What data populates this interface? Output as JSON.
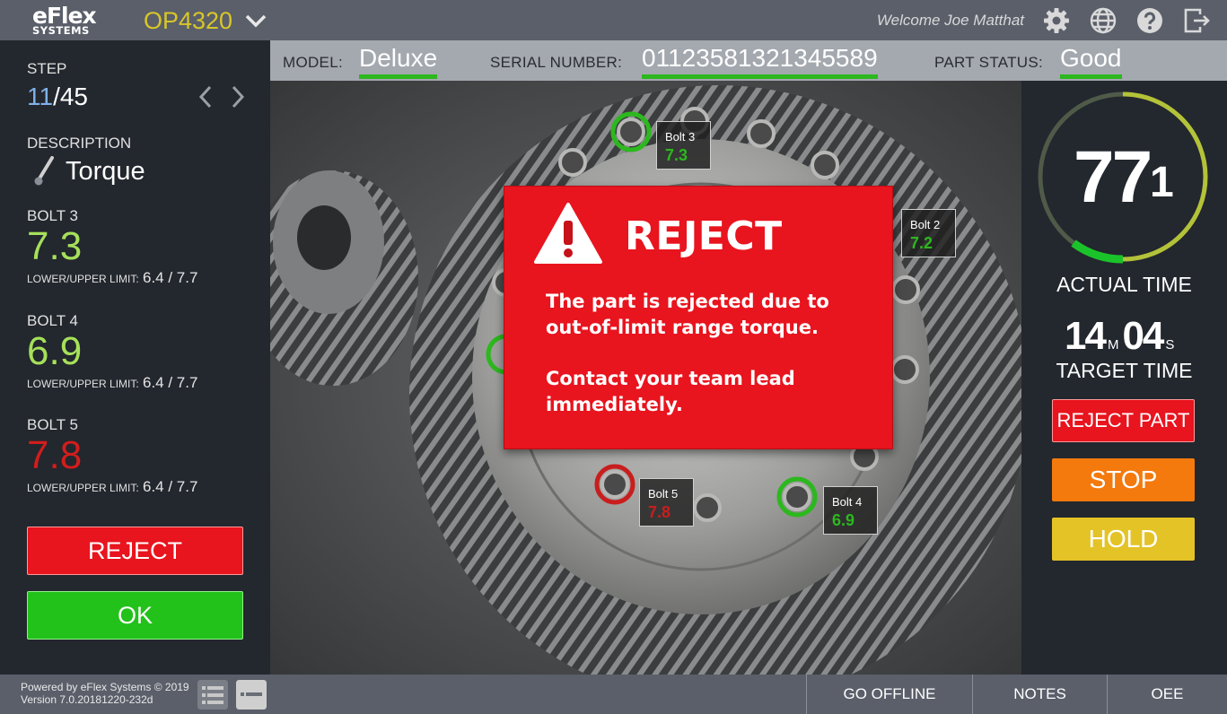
{
  "header": {
    "logo_line1": "eFlex",
    "logo_line2": "SYSTEMS",
    "operation": "OP4320",
    "welcome": "Welcome Joe Matthat",
    "icons": [
      "settings-gear-icon",
      "language-globe-icon",
      "help-icon",
      "logout-icon"
    ]
  },
  "infobar": {
    "model_label": "MODEL:",
    "model_value": "Deluxe",
    "serial_label": "SERIAL NUMBER:",
    "serial_value": "01123581321345589",
    "status_label": "PART STATUS:",
    "status_value": "Good"
  },
  "step": {
    "label": "STEP",
    "current": "11",
    "total": "/45"
  },
  "description": {
    "label": "DESCRIPTION",
    "value": "Torque"
  },
  "bolts": [
    {
      "label": "BOLT 3",
      "value": "7.3",
      "limit_label": "LOWER/UPPER LIMIT:",
      "limit": "6.4 / 7.7",
      "color": "#a6e05a"
    },
    {
      "label": "BOLT 4",
      "value": "6.9",
      "limit_label": "LOWER/UPPER LIMIT:",
      "limit": "6.4 / 7.7",
      "color": "#a6e05a"
    },
    {
      "label": "BOLT 5",
      "value": "7.8",
      "limit_label": "LOWER/UPPER LIMIT:",
      "limit": "6.4 / 7.7",
      "color": "#d21d1d"
    }
  ],
  "buttons": {
    "reject": "REJECT",
    "ok": "OK"
  },
  "overlay_labels": [
    {
      "name": "Bolt 3",
      "value": "7.3",
      "color": "#2cb81e"
    },
    {
      "name": "Bolt 2",
      "value": "7.2",
      "color": "#2cb81e"
    },
    {
      "name": "Bolt 5",
      "value": "7.8",
      "color": "#c81e1e"
    },
    {
      "name": "Bolt 4",
      "value": "6.9",
      "color": "#2cb81e"
    }
  ],
  "modal": {
    "title": "REJECT",
    "line1": "The part is rejected due to",
    "line2": "out-of-limit range torque.",
    "line3": "Contact your team lead",
    "line4": "immediately."
  },
  "timer": {
    "actual_big": "77",
    "actual_small": "1",
    "actual_label": "ACTUAL TIME",
    "target_min": "14",
    "target_min_unit": "M",
    "target_sec": "04",
    "target_sec_unit": "S",
    "target_label": "TARGET TIME"
  },
  "actions": {
    "reject_part": "REJECT PART",
    "stop": "STOP",
    "hold": "HOLD"
  },
  "footer": {
    "powered": "Powered by eFlex Systems © 2019",
    "version": "Version 7.0.20181220-232d",
    "go_offline": "GO OFFLINE",
    "notes": "NOTES",
    "oee": "OEE"
  },
  "colors": {
    "accent_green": "#2cb81e",
    "reject_red": "#e8141e",
    "stop_orange": "#f47a0e",
    "hold_yellow": "#e4c326",
    "op_yellow": "#d8c628"
  }
}
